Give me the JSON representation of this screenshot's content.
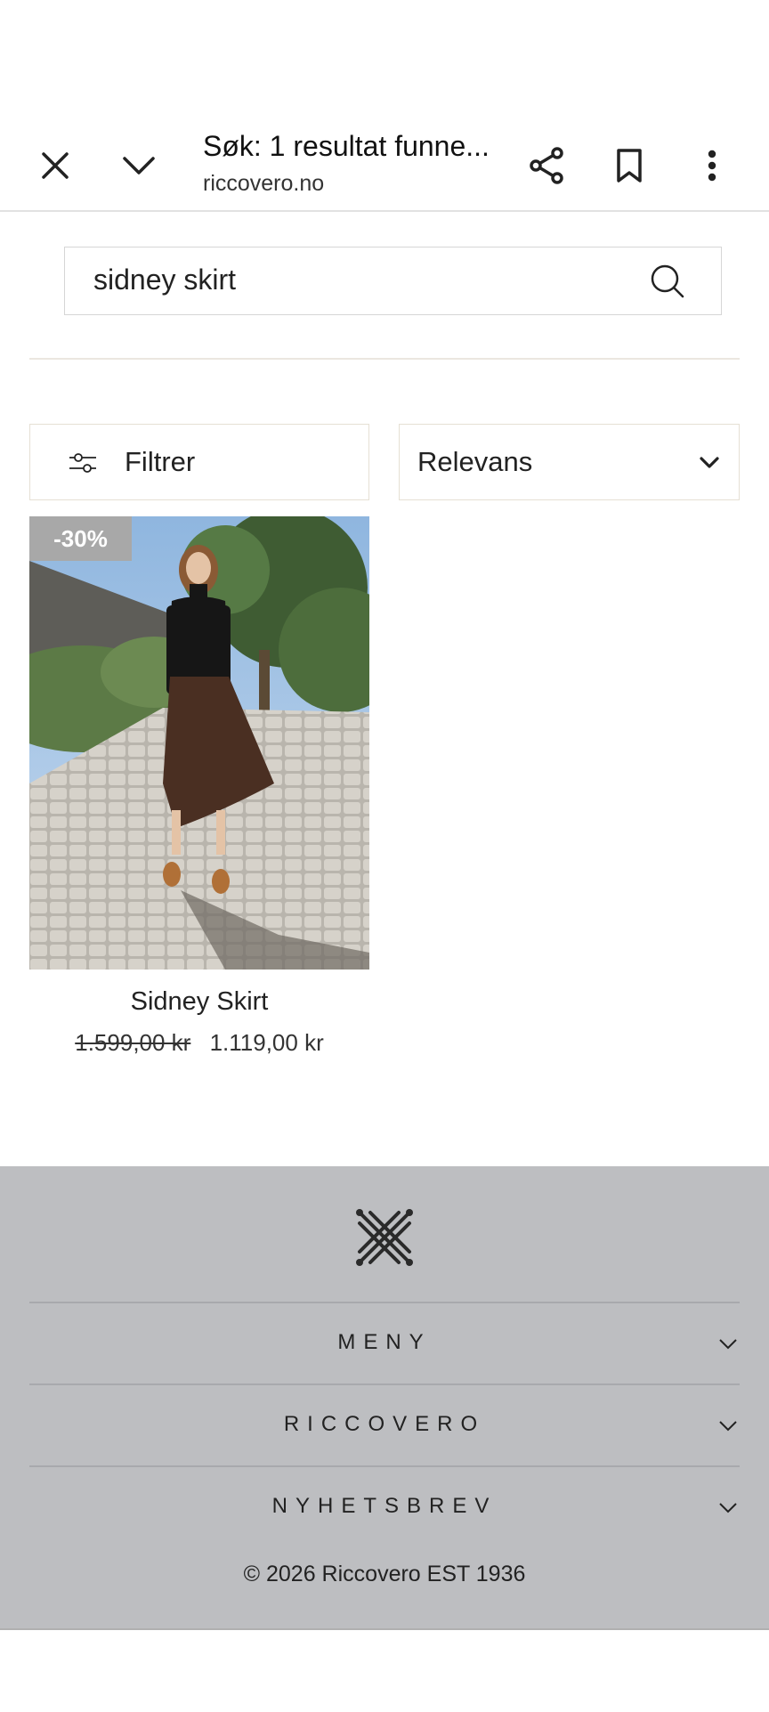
{
  "browser": {
    "title": "Søk: 1 resultat funne...",
    "url": "riccovero.no",
    "icons": [
      "close-icon",
      "chevron-down-icon",
      "share-icon",
      "bookmark-icon",
      "more-vert-icon"
    ]
  },
  "search": {
    "value": "sidney skirt",
    "icon": "search-icon"
  },
  "toolbar": {
    "filter_label": "Filtrer",
    "sort_label": "Relevans"
  },
  "products": [
    {
      "name": "Sidney Skirt",
      "badge": "-30%",
      "old_price": "1.599,00 kr",
      "price": "1.119,00 kr"
    }
  ],
  "footer": {
    "logo_icon": "riccovero-logo-icon",
    "rows": [
      {
        "label": "MENY"
      },
      {
        "label": "RICCOVERO"
      },
      {
        "label": "NYHETSBREV"
      }
    ],
    "copyright": "© 2026 Riccovero EST 1936"
  },
  "colors": {
    "footer_bg": "#bdbec1",
    "badge_bg": "#a8a8a8",
    "border": "#e6e0d4"
  }
}
